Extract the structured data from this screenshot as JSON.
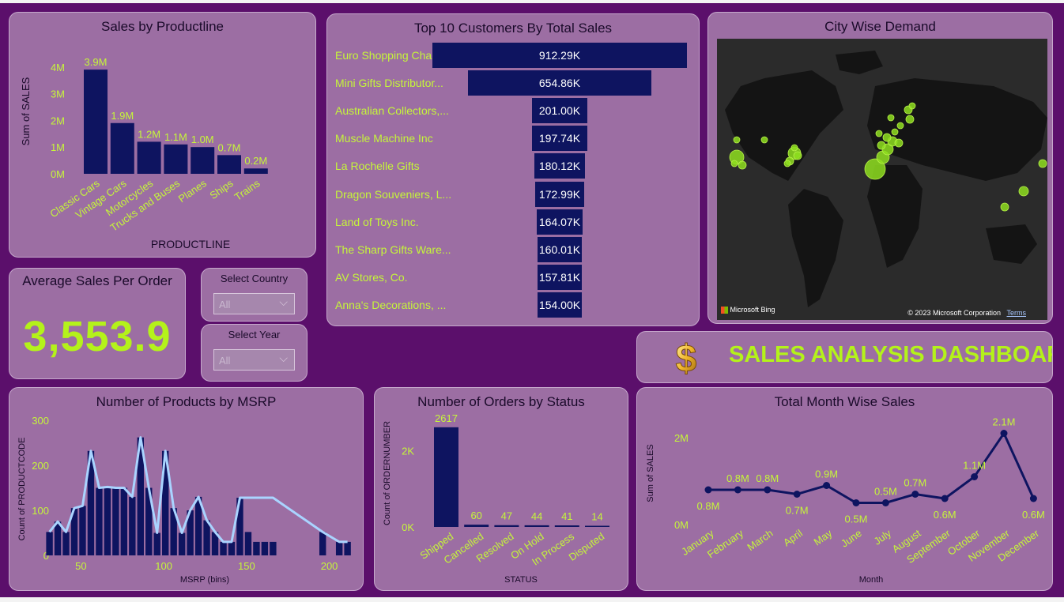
{
  "dashboard": {
    "title": "SALES ANALYSIS DASHBOARD",
    "colors": {
      "background": "#5b0f6b",
      "panel": "#9c6ea3",
      "bar": "#0e1460",
      "label": "#c5f53a",
      "accent_line": "#a9d4ff"
    }
  },
  "kpi": {
    "title": "Average Sales Per Order",
    "value": "3,553.9"
  },
  "slicers": {
    "country": {
      "title": "Select Country",
      "value": "All"
    },
    "year": {
      "title": "Select Year",
      "value": "All"
    }
  },
  "map": {
    "title": "City Wise Demand",
    "credit_left": "Microsoft Bing",
    "credit_right": "© 2023 Microsoft Corporation",
    "terms": "Terms"
  },
  "chart_data": [
    {
      "id": "productline",
      "type": "bar",
      "title": "Sales by Productline",
      "xlabel": "PRODUCTLINE",
      "ylabel": "Sum of SALES",
      "categories": [
        "Classic Cars",
        "Vintage Cars",
        "Motorcycles",
        "Trucks and Buses",
        "Planes",
        "Ships",
        "Trains"
      ],
      "values": [
        3.9,
        1.9,
        1.2,
        1.1,
        1.0,
        0.7,
        0.2
      ],
      "value_labels": [
        "3.9M",
        "1.9M",
        "1.2M",
        "1.1M",
        "1.0M",
        "0.7M",
        "0.2M"
      ],
      "yticks": [
        "0M",
        "1M",
        "2M",
        "3M",
        "4M"
      ],
      "ylim": [
        0,
        4.2
      ]
    },
    {
      "id": "customers",
      "type": "bar",
      "orientation": "horizontal",
      "title": "Top 10 Customers By Total Sales",
      "categories": [
        "Euro Shopping Chan...",
        "Mini Gifts Distributor...",
        "Australian Collectors,...",
        "Muscle Machine Inc",
        "La Rochelle Gifts",
        "Dragon Souveniers, L...",
        "Land of Toys Inc.",
        "The Sharp Gifts Ware...",
        "AV Stores, Co.",
        "Anna's Decorations, ..."
      ],
      "values": [
        912.29,
        654.86,
        201.0,
        197.74,
        180.12,
        172.99,
        164.07,
        160.01,
        157.81,
        154.0
      ],
      "value_labels": [
        "912.29K",
        "654.86K",
        "201.00K",
        "197.74K",
        "180.12K",
        "172.99K",
        "164.07K",
        "160.01K",
        "157.81K",
        "154.00K"
      ]
    },
    {
      "id": "msrp",
      "type": "bar",
      "title": "Number of Products by MSRP",
      "xlabel": "MSRP (bins)",
      "ylabel": "Count of PRODUCTCODE",
      "x": [
        29,
        34,
        39,
        44,
        49,
        54,
        59,
        64,
        69,
        74,
        79,
        84,
        89,
        94,
        99,
        104,
        109,
        114,
        119,
        124,
        129,
        134,
        139,
        144,
        149,
        154,
        159,
        164,
        194,
        204,
        209
      ],
      "values": [
        52,
        75,
        52,
        105,
        110,
        232,
        150,
        152,
        150,
        150,
        130,
        262,
        150,
        50,
        232,
        105,
        50,
        100,
        130,
        78,
        52,
        30,
        30,
        128,
        52,
        30,
        30,
        30,
        52,
        30,
        30
      ],
      "line_x": [
        29,
        34,
        39,
        44,
        49,
        54,
        59,
        64,
        69,
        74,
        79,
        84,
        89,
        94,
        99,
        104,
        109,
        114,
        119,
        124,
        129,
        134,
        139,
        144,
        164,
        194,
        204,
        209
      ],
      "line_values": [
        52,
        75,
        52,
        105,
        110,
        232,
        150,
        152,
        150,
        150,
        130,
        262,
        150,
        50,
        232,
        105,
        50,
        100,
        130,
        78,
        52,
        30,
        30,
        128,
        128,
        52,
        30,
        30
      ],
      "xticks": [
        "50",
        "100",
        "150",
        "200"
      ],
      "yticks": [
        "0",
        "100",
        "200",
        "300"
      ],
      "ylim": [
        0,
        300
      ],
      "xlim": [
        25,
        215
      ]
    },
    {
      "id": "status",
      "type": "bar",
      "title": "Number of Orders by Status",
      "xlabel": "STATUS",
      "ylabel": "Count of ORDERNUMBER",
      "categories": [
        "Shipped",
        "Cancelled",
        "Resolved",
        "On Hold",
        "In Process",
        "Disputed"
      ],
      "values": [
        2617,
        60,
        47,
        44,
        41,
        14
      ],
      "value_labels": [
        "2617",
        "60",
        "47",
        "44",
        "41",
        "14"
      ],
      "yticks": [
        "0K",
        "2K"
      ],
      "ylim": [
        0,
        2800
      ]
    },
    {
      "id": "monthly",
      "type": "line",
      "title": "Total Month Wise Sales",
      "xlabel": "Month",
      "ylabel": "Sum of SALES",
      "categories": [
        "January",
        "February",
        "March",
        "April",
        "May",
        "June",
        "July",
        "August",
        "September",
        "October",
        "November",
        "December"
      ],
      "values": [
        0.8,
        0.8,
        0.8,
        0.7,
        0.9,
        0.5,
        0.5,
        0.7,
        0.6,
        1.1,
        2.1,
        0.6
      ],
      "value_labels": [
        "0.8M",
        "0.8M",
        "0.8M",
        "0.7M",
        "0.9M",
        "0.5M",
        "0.5M",
        "0.7M",
        "0.6M",
        "1.1M",
        "2.1M",
        "0.6M"
      ],
      "yticks": [
        "0M",
        "2M"
      ],
      "ylim": [
        0,
        2.4
      ]
    }
  ]
}
